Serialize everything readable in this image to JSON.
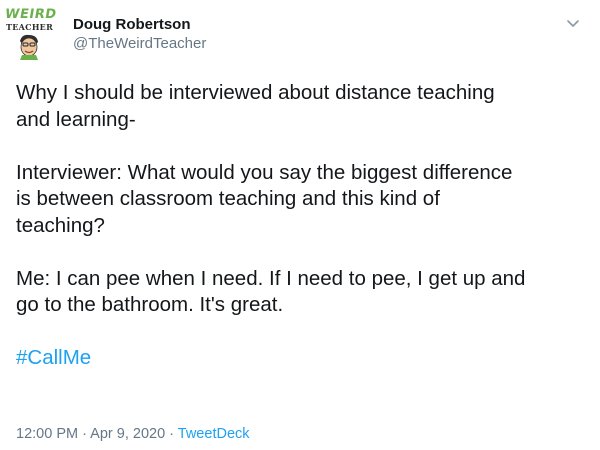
{
  "user": {
    "display_name": "Doug Robertson",
    "handle": "@TheWeirdTeacher",
    "avatar_logo_text": "WEIRD",
    "avatar_logo_subtext": "TEACHER"
  },
  "tweet": {
    "paragraphs": [
      "Why I should be interviewed about distance teaching\nand learning-",
      "Interviewer: What would you say the biggest difference\nis between classroom teaching and this kind of\nteaching?",
      "Me: I can pee when I need. If I need to pee, I get up and\ngo to the bathroom. It's great."
    ],
    "hashtag": "#CallMe"
  },
  "meta": {
    "time": "12:00 PM",
    "separator": " · ",
    "date": "Apr 9, 2020",
    "source": "TweetDeck"
  },
  "colors": {
    "text": "#14171a",
    "secondary": "#657786",
    "link": "#1da1f2",
    "logo_green": "#6ab04c"
  },
  "icons": {
    "menu": "chevron-down-icon"
  }
}
